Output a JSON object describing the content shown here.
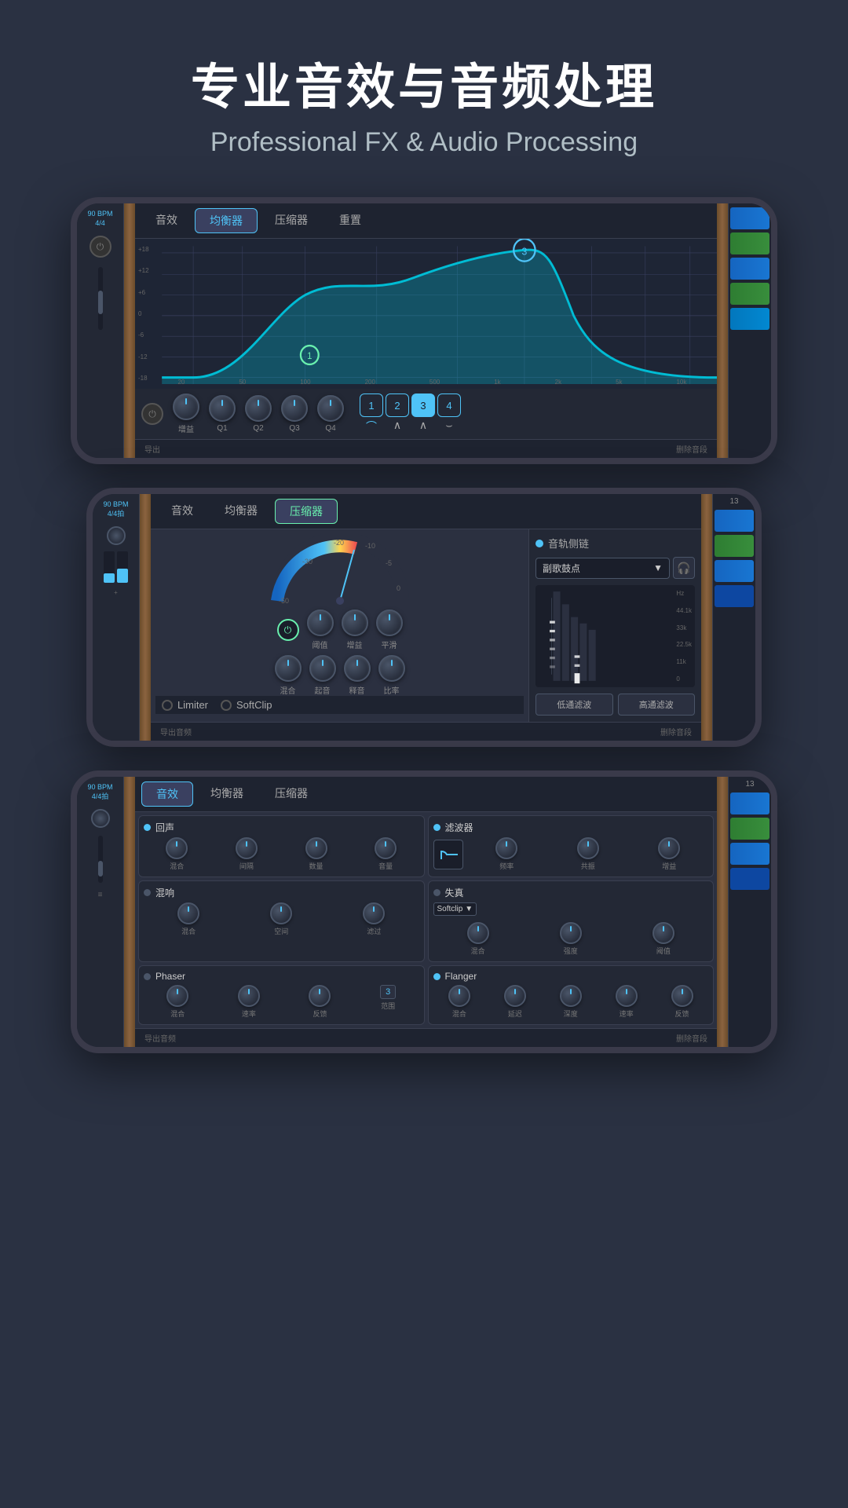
{
  "header": {
    "title_cn": "专业音效与音频处理",
    "title_en": "Professional FX & Audio Processing"
  },
  "phone1": {
    "bpm": "90 BPM",
    "time_sig": "4/4",
    "tabs": [
      "音效",
      "均衡器",
      "压缩器",
      "重置"
    ],
    "active_tab": "均衡器",
    "eq_labels_y": [
      "+18",
      "+12",
      "+6",
      "0",
      "-6",
      "-12",
      "-18"
    ],
    "eq_labels_x": [
      "20",
      "50",
      "100",
      "200",
      "500",
      "1k",
      "2k",
      "5k",
      "10k"
    ],
    "knobs": [
      "增益",
      "Q1",
      "Q2",
      "Q3",
      "Q4"
    ],
    "band_buttons": [
      "1",
      "2",
      "3",
      "4"
    ],
    "active_band": "3",
    "band_shapes": [
      "⌒",
      "∧",
      "∧",
      "⌣"
    ],
    "footer_left": "导出",
    "footer_right": "删除音段"
  },
  "phone2": {
    "bpm": "90 BPM",
    "time_sig": "4/4拍",
    "tabs": [
      "音效",
      "均衡器",
      "压缩器"
    ],
    "active_tab": "压缩器",
    "knobs_row1": [
      "阈值",
      "增益",
      "平滑"
    ],
    "knobs_row2": [
      "混合",
      "起音",
      "释音",
      "比率"
    ],
    "sidechain_label": "音轨侧链",
    "sidechain_track": "副歌鼓点",
    "spectrum_labels": [
      "Hz",
      "44.1k",
      "33k",
      "22.5k",
      "11k",
      "0"
    ],
    "filter_low": "低通滤波",
    "filter_high": "高通滤波",
    "limiter_label": "Limiter",
    "softclip_label": "SoftClip",
    "footer_left": "导出音频",
    "footer_right": "删除音段"
  },
  "phone3": {
    "bpm": "90 BPM",
    "time_sig": "4/4拍",
    "tabs": [
      "音效",
      "均衡器",
      "压缩器"
    ],
    "active_tab": "音效",
    "effects": [
      {
        "id": "reverb",
        "title": "回声",
        "active": true,
        "knobs": [
          "混合",
          "间隔",
          "数量",
          "音量"
        ]
      },
      {
        "id": "filter",
        "title": "滤波器",
        "active": true,
        "knobs": [
          "频率",
          "共振",
          "增益"
        ],
        "has_shape": true
      },
      {
        "id": "chorus",
        "title": "混响",
        "active": false,
        "knobs": [
          "混合",
          "空间",
          "滤过"
        ]
      },
      {
        "id": "distortion",
        "title": "失真",
        "active": false,
        "dropdown": "Softclip",
        "knobs": [
          "混合",
          "强度",
          "阈值"
        ]
      },
      {
        "id": "phaser",
        "title": "Phaser",
        "active": false,
        "knobs": [
          "混合",
          "速率",
          "反馈",
          "范围"
        ],
        "has_number": true,
        "number_val": "3"
      },
      {
        "id": "flanger",
        "title": "Flanger",
        "active": true,
        "knobs": [
          "混合",
          "延迟",
          "深度",
          "速率",
          "反馈"
        ]
      }
    ],
    "footer_left": "导出音频",
    "footer_right": "删除音段"
  }
}
